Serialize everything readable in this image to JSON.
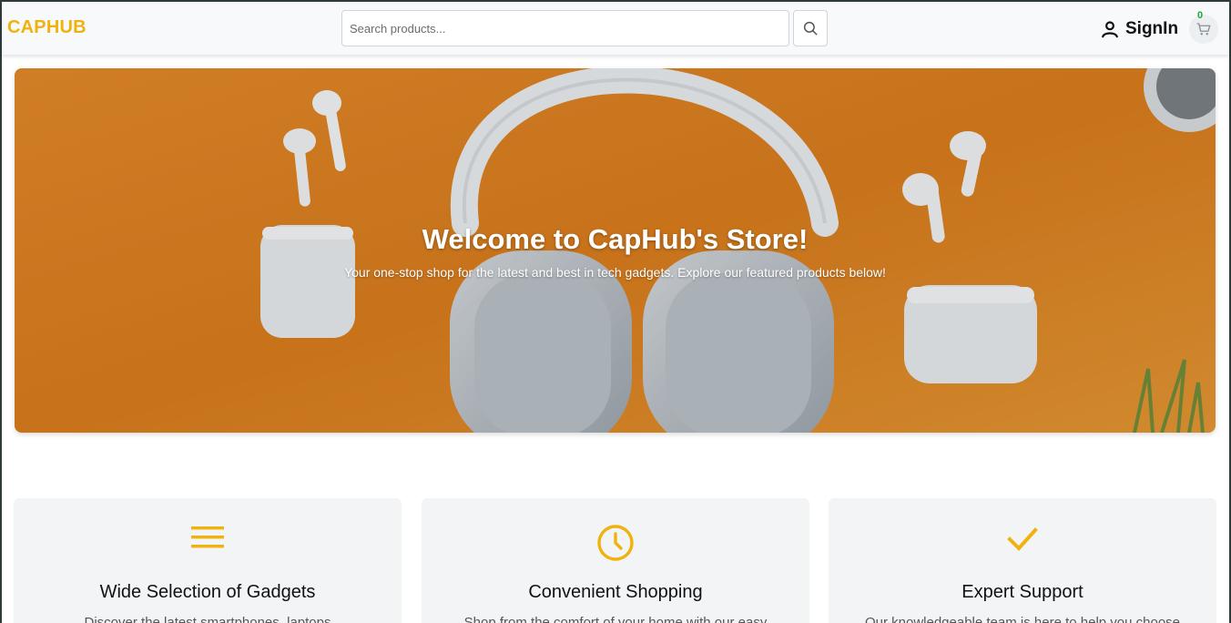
{
  "header": {
    "logo": "CAPHUB",
    "search_placeholder": "Search products...",
    "signin_label": "SignIn",
    "cart_count": "0"
  },
  "hero": {
    "title": "Welcome to CapHub's Store!",
    "subtitle": "Your one-stop shop for the latest and best in tech gadgets. Explore our featured products below!"
  },
  "features": [
    {
      "icon": "menu-lines-icon",
      "title": "Wide Selection of Gadgets",
      "description": "Discover the latest smartphones, laptops"
    },
    {
      "icon": "clock-icon",
      "title": "Convenient Shopping",
      "description": "Shop from the comfort of your home with our easy"
    },
    {
      "icon": "checkmark-icon",
      "title": "Expert Support",
      "description": "Our knowledgeable team is here to help you choose"
    }
  ],
  "colors": {
    "brand": "#f0b20f",
    "cart_badge": "#23a43a",
    "hero_background": "#e08a24"
  }
}
